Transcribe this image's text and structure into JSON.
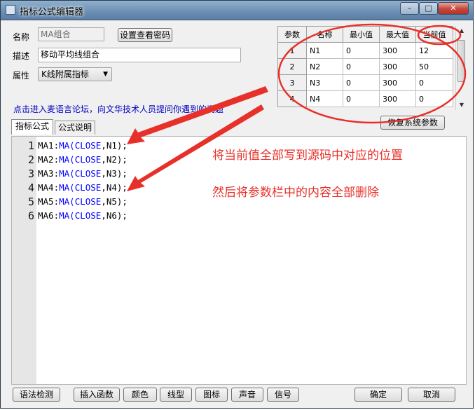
{
  "window": {
    "title": "指标公式编辑器",
    "min_icon": "minimize-icon",
    "max_icon": "maximize-icon",
    "close_icon": "close-icon"
  },
  "form": {
    "name_label": "名称",
    "name_value": "MA组合",
    "password_button": "设置查看密码",
    "desc_label": "描述",
    "desc_value": "移动平均线组合",
    "attr_label": "属性",
    "attr_value": "K线附属指标"
  },
  "forum_link": "点击进入麦语言论坛，向文华技术人员提问你遇到的问题",
  "params": {
    "headers": [
      "参数",
      "名称",
      "最小值",
      "最大值",
      "当前值"
    ],
    "rows": [
      {
        "idx": "1",
        "name": "N1",
        "min": "0",
        "max": "300",
        "cur": "12"
      },
      {
        "idx": "2",
        "name": "N2",
        "min": "0",
        "max": "300",
        "cur": "50"
      },
      {
        "idx": "3",
        "name": "N3",
        "min": "0",
        "max": "300",
        "cur": "0"
      },
      {
        "idx": "4",
        "name": "N4",
        "min": "0",
        "max": "300",
        "cur": "0"
      }
    ],
    "restore_button": "恢复系统参数"
  },
  "tabs": [
    "指标公式",
    "公式说明"
  ],
  "code": [
    {
      "num": "1",
      "pre": "MA1:",
      "fn": "MA(",
      "kw": "CLOSE",
      "post": ",N1);"
    },
    {
      "num": "2",
      "pre": "MA2:",
      "fn": "MA(",
      "kw": "CLOSE",
      "post": ",N2);"
    },
    {
      "num": "3",
      "pre": "MA3:",
      "fn": "MA(",
      "kw": "CLOSE",
      "post": ",N3);"
    },
    {
      "num": "4",
      "pre": "MA4:",
      "fn": "MA(",
      "kw": "CLOSE",
      "post": ",N4);"
    },
    {
      "num": "5",
      "pre": "MA5:",
      "fn": "MA(",
      "kw": "CLOSE",
      "post": ",N5);"
    },
    {
      "num": "6",
      "pre": "MA6:",
      "fn": "MA(",
      "kw": "CLOSE",
      "post": ",N6);"
    }
  ],
  "annotations": {
    "line1": "将当前值全部写到源码中对应的位置",
    "line2": "然后将参数栏中的内容全部删除",
    "color": "#e8302a"
  },
  "buttons": {
    "syntax": "语法检测",
    "insert": "插入函数",
    "color": "颜色",
    "linetype": "线型",
    "icon": "图标",
    "sound": "声音",
    "signal": "信号",
    "ok": "确定",
    "cancel": "取消"
  }
}
